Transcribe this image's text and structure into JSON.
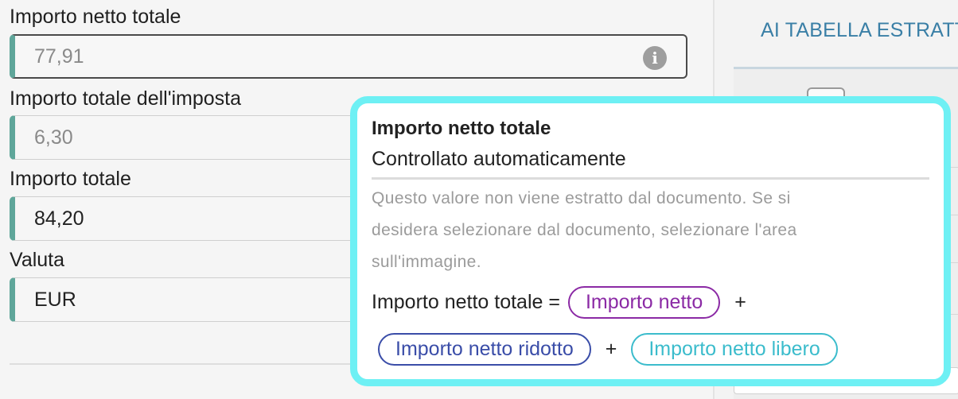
{
  "form": {
    "fields": [
      {
        "label": "Importo netto totale",
        "value": "77,91"
      },
      {
        "label": "Importo totale dell'imposta",
        "value": "6,30"
      },
      {
        "label": "Importo totale",
        "value": "84,20"
      },
      {
        "label": "Valuta",
        "value": "EUR"
      }
    ],
    "info_icon": "i"
  },
  "right_panel": {
    "tab_label": "AI TABELLA ESTRATTA"
  },
  "popover": {
    "title": "Importo netto totale",
    "subtitle": "Controllato automaticamente",
    "description_lines": [
      "Questo valore non viene estratto dal documento. Se si",
      "desidera selezionare dal documento, selezionare l'area",
      "sull'immagine."
    ],
    "formula_lhs": "Importo netto totale =",
    "formula_terms": [
      "Importo netto",
      "Importo netto ridotto",
      "Importo netto libero"
    ],
    "plus": "+",
    "colors": {
      "border": "#6ef0f4",
      "term1": "#8b2aa5",
      "term2": "#3a4da8",
      "term3": "#3bbccc"
    }
  }
}
